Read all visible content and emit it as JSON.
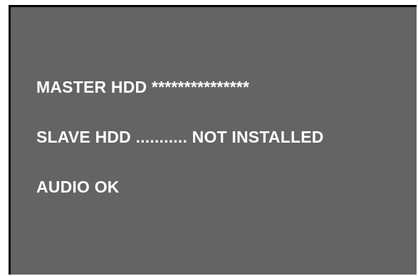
{
  "colors": {
    "screen_background": "#646464",
    "text": "#ffffff",
    "border": "#000000",
    "page_background": "#ffffff"
  },
  "status_lines": [
    "MASTER HDD ***************",
    "SLAVE HDD ........... NOT INSTALLED",
    "AUDIO OK"
  ]
}
